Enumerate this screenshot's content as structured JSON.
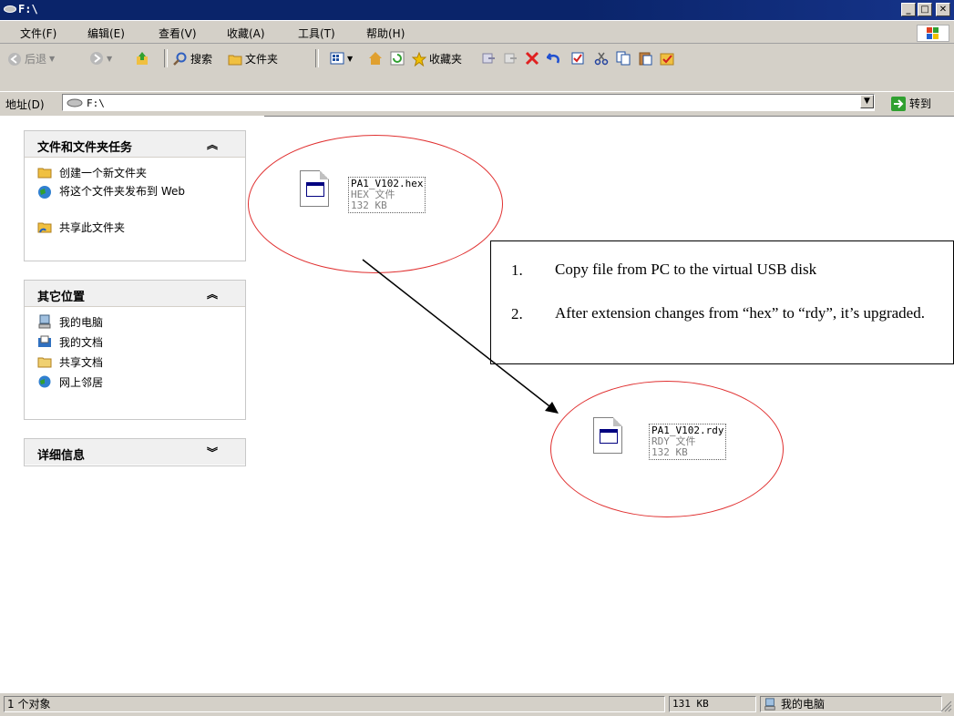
{
  "window": {
    "title": "F:\\",
    "minimize_glyph": "_",
    "maximize_glyph": "□",
    "close_glyph": "✕"
  },
  "menu": [
    "文件(F)",
    "编辑(E)",
    "查看(V)",
    "收藏(A)",
    "工具(T)",
    "帮助(H)"
  ],
  "toolbar": {
    "back_label": "后退",
    "search_label": "搜索",
    "folders_label": "文件夹",
    "favorites_label": "收藏夹"
  },
  "address": {
    "label": "地址(D)",
    "value": "F:\\",
    "go_label": "转到"
  },
  "tasks_panel": {
    "title": "文件和文件夹任务",
    "items": [
      {
        "label": "创建一个新文件夹",
        "icon": "new-folder-icon"
      },
      {
        "label": "将这个文件夹发布到 Web",
        "icon": "publish-web-icon"
      },
      {
        "label": "共享此文件夹",
        "icon": "share-folder-icon"
      }
    ]
  },
  "places_panel": {
    "title": "其它位置",
    "items": [
      {
        "label": "我的电脑",
        "icon": "my-computer-icon"
      },
      {
        "label": "我的文档",
        "icon": "my-documents-icon"
      },
      {
        "label": "共享文档",
        "icon": "shared-documents-icon"
      },
      {
        "label": "网上邻居",
        "icon": "network-places-icon"
      }
    ]
  },
  "details_panel": {
    "title": "详细信息"
  },
  "files": [
    {
      "name": "PA1_V102.hex",
      "type": "HEX 文件",
      "size": "132 KB"
    },
    {
      "name": "PA1_V102.rdy",
      "type": "RDY 文件",
      "size": "132 KB"
    }
  ],
  "notes": [
    {
      "num": "1.",
      "text": "Copy file from PC to the virtual USB disk"
    },
    {
      "num": "2.",
      "text": "After extension changes from “hex” to “rdy”, it’s upgraded."
    }
  ],
  "status": {
    "objects": "1 个对象",
    "size": "131 KB",
    "location": "我的电脑"
  },
  "colors": {
    "titlebar": "#0a246a",
    "chrome": "#d4d0c8",
    "annotation_ellipse": "#e03030"
  }
}
